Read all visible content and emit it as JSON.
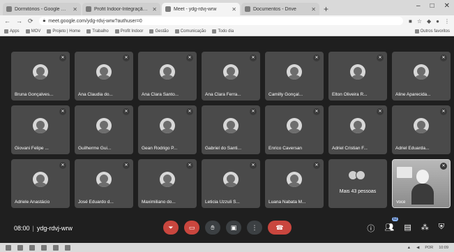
{
  "browser": {
    "tabs": [
      {
        "label": "Dormitórios - Google Meet",
        "active": false
      },
      {
        "label": "Profit Indoor-Integração col...",
        "active": false
      },
      {
        "label": "Meet - ydg-rdvj-wrw",
        "active": true
      },
      {
        "label": "Documentos - Drive",
        "active": false
      }
    ],
    "new_tab": "+",
    "window_controls": [
      "–",
      "□",
      "✕"
    ],
    "url": "meet.google.com/ydg-rdvj-wrw?authuser=0",
    "bookmarks": [
      "Apps",
      "MOV",
      "Projeto | Home",
      "Trabalho",
      "Profit Indoor",
      "Gestão",
      "Comunicação",
      "Todo dia",
      "Outros favoritos"
    ]
  },
  "meet": {
    "participants": [
      "Bruna Gonçalves...",
      "Ana Claudia do...",
      "Ana Clara Santo...",
      "Ana Clara Ferra...",
      "Camilly Gonçal...",
      "Elton Oliveira R...",
      "Aline Aparecida...",
      "Giovani Felipe ...",
      "Guilherme Gui...",
      "Gean Rodrigo P...",
      "Gabriel do Santi...",
      "Enrico Caversan",
      "Adriel Cristian F...",
      "Adriel Eduarda...",
      "Adriele Anastácio",
      "José Eduardo d...",
      "Maximiliano do...",
      "Leticia Uzzuli S...",
      "Luana Nabata M..."
    ],
    "more_label": "Mais 43 pessoas",
    "self_label": "Você",
    "clock": "08:00",
    "separator": "|",
    "meeting_code": "ydg-rdvj-wrw",
    "participants_count": "62"
  },
  "icons": {
    "mic_off": "mic-off-icon",
    "camera": "camera-icon",
    "hand": "raise-hand-icon",
    "present": "present-icon",
    "more": "more-options-icon",
    "end_call": "end-call-icon",
    "info": "info-icon",
    "people": "people-icon",
    "chat": "chat-icon",
    "activities": "activities-icon",
    "host": "host-controls-icon"
  },
  "taskbar": {
    "time": "10:09",
    "lang": "POR"
  }
}
